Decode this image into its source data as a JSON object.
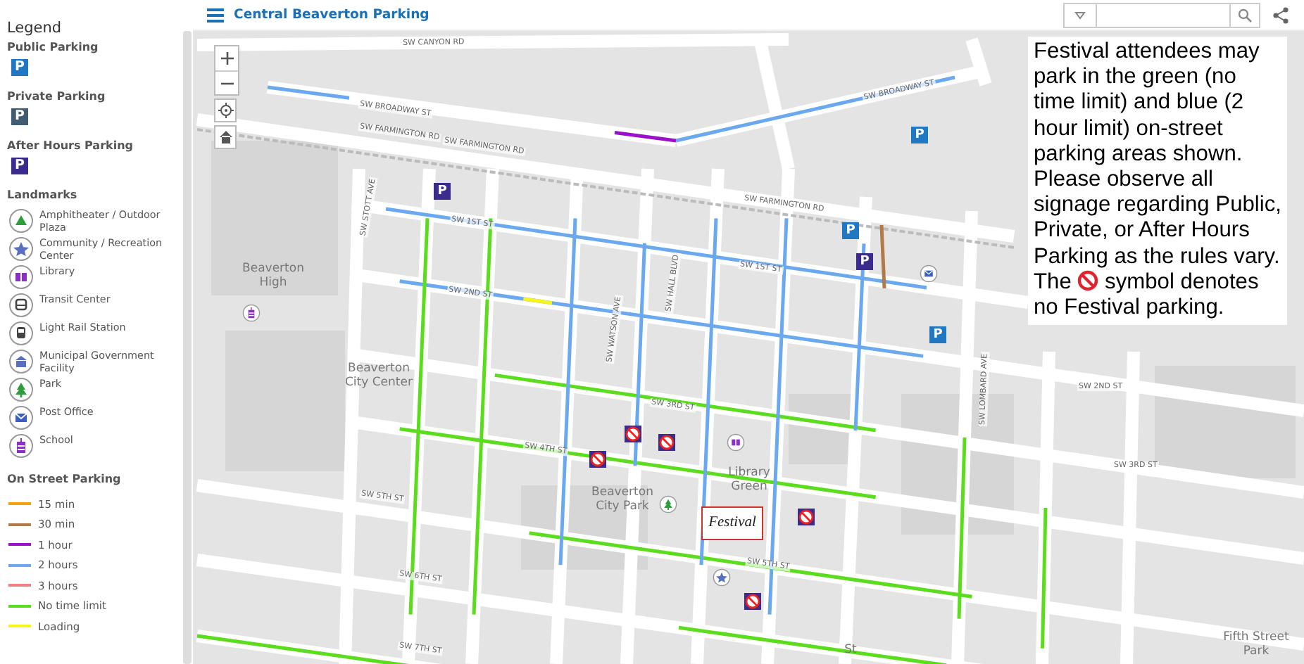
{
  "header": {
    "title": "Central Beaverton Parking"
  },
  "legend": {
    "title": "Legend",
    "sections": [
      {
        "kind": "parking",
        "heading": "Public Parking",
        "items": [
          {
            "label": "P",
            "color": "#1f78c1"
          }
        ]
      },
      {
        "kind": "parking",
        "heading": "Private Parking",
        "items": [
          {
            "label": "P",
            "color": "#3f5c70"
          }
        ]
      },
      {
        "kind": "parking",
        "heading": "After Hours Parking",
        "items": [
          {
            "label": "P",
            "color": "#3b2b8c"
          }
        ]
      },
      {
        "kind": "landmarks",
        "heading": "Landmarks",
        "items": [
          {
            "label": "Amphitheater / Outdoor Plaza",
            "kind": "amphitheater"
          },
          {
            "label": "Community / Recreation Center",
            "kind": "community"
          },
          {
            "label": "Library",
            "kind": "library"
          },
          {
            "label": "Transit Center",
            "kind": "transit"
          },
          {
            "label": "Light Rail Station",
            "kind": "rail"
          },
          {
            "label": "Municipal Government Facility",
            "kind": "government"
          },
          {
            "label": "Park",
            "kind": "park"
          },
          {
            "label": "Post Office",
            "kind": "post"
          },
          {
            "label": "School",
            "kind": "school"
          }
        ]
      },
      {
        "kind": "lines",
        "heading": "On Street Parking",
        "items": [
          {
            "label": "15 min",
            "color": "#f0a30a"
          },
          {
            "label": "30 min",
            "color": "#b07a4a"
          },
          {
            "label": "1 hour",
            "color": "#9b10c9"
          },
          {
            "label": "2 hours",
            "color": "#6aa9f0"
          },
          {
            "label": "3 hours",
            "color": "#f08080"
          },
          {
            "label": "No time limit",
            "color": "#5bdc1c"
          },
          {
            "label": "Loading",
            "color": "#f5f51a"
          }
        ]
      }
    ]
  },
  "map": {
    "labels": [
      {
        "kind": "street",
        "text": "SW CANYON RD"
      },
      {
        "kind": "street",
        "text": "SW BROADWAY ST"
      },
      {
        "kind": "street",
        "text": "SW FARMINGTON RD"
      },
      {
        "kind": "street",
        "text": "SW FARMINGTON RD"
      },
      {
        "kind": "street",
        "text": "SW FARMINGTON RD"
      },
      {
        "kind": "street",
        "text": "SW BROADWAY ST"
      },
      {
        "kind": "street",
        "text": "SW 1ST ST"
      },
      {
        "kind": "street",
        "text": "SW 1ST ST"
      },
      {
        "kind": "street",
        "text": "SW 2ND ST"
      },
      {
        "kind": "street",
        "text": "SW 2ND ST"
      },
      {
        "kind": "street",
        "text": "SW 3RD ST"
      },
      {
        "kind": "street",
        "text": "SW 3RD ST"
      },
      {
        "kind": "street",
        "text": "SW 4TH ST"
      },
      {
        "kind": "street",
        "text": "SW 5TH ST"
      },
      {
        "kind": "street",
        "text": "SW 5TH ST"
      },
      {
        "kind": "street",
        "text": "SW 6TH ST"
      },
      {
        "kind": "street",
        "text": "SW 7TH ST"
      },
      {
        "kind": "street",
        "text": "SW WATSON AVE"
      },
      {
        "kind": "street",
        "text": "SW HALL BLVD"
      },
      {
        "kind": "street",
        "text": "SW LOMBARD AVE"
      },
      {
        "kind": "street",
        "text": "SW STOTT AVE"
      },
      {
        "kind": "place",
        "text": "Beaverton High"
      },
      {
        "kind": "place",
        "text": "Beaverton City Center"
      },
      {
        "kind": "place",
        "text": "Beaverton City Park"
      },
      {
        "kind": "place",
        "text": "Library Green"
      },
      {
        "kind": "place",
        "text": "St"
      },
      {
        "kind": "place",
        "text": "Fifth Street Park"
      }
    ],
    "parking_markers": [
      {
        "label": "P",
        "color": "#1f78c1"
      },
      {
        "label": "P",
        "color": "#1f78c1"
      },
      {
        "label": "P",
        "color": "#1f78c1"
      },
      {
        "label": "P",
        "color": "#3b2b8c"
      },
      {
        "label": "P",
        "color": "#3b2b8c"
      }
    ],
    "festival_logo": "Festival",
    "info_box": {
      "text_before": "Festival attendees may park in the green (no time limit) and blue (2 hour limit) on-street parking areas shown. Please observe all signage regarding Public, Private, or After Hours Parking as the rules vary. The",
      "text_after": "symbol denotes no Festival parking."
    }
  }
}
